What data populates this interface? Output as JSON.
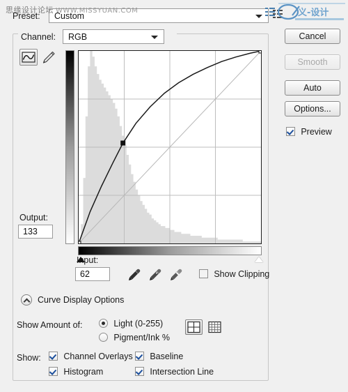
{
  "dialog": {
    "watermark_cn": "思缘设计论坛",
    "watermark_url": "WWW.MISSYUAN.COM",
    "logo_name": "missyuan-logo"
  },
  "preset": {
    "label": "Preset:",
    "value": "Custom",
    "menu_icon": "preset-menu-icon"
  },
  "channel": {
    "label": "Channel:",
    "value": "RGB"
  },
  "tools": {
    "curve_icon": "curve-draw-icon",
    "pencil_icon": "pencil-icon"
  },
  "graph": {
    "output_label": "Output:",
    "output_value": "133",
    "input_label": "Input:",
    "input_value": "62",
    "black_slider": "black-point-slider",
    "white_slider": "white-point-slider"
  },
  "eyedroppers": {
    "black": "black-point-eyedropper",
    "gray": "gray-point-eyedropper",
    "white": "white-point-eyedropper"
  },
  "show_clipping": {
    "label": "Show Clipping",
    "checked": false
  },
  "curve_display_options": {
    "title": "Curve Display Options",
    "expanded": true,
    "show_amount_label": "Show Amount of:",
    "radio_light": "Light  (0-255)",
    "radio_pigment": "Pigment/Ink %",
    "radio_selected": "light",
    "grid_coarse": "grid-coarse-button",
    "grid_fine": "grid-fine-button",
    "grid_selected": "coarse",
    "show_label": "Show:",
    "checkboxes": [
      {
        "label": "Channel Overlays",
        "checked": true
      },
      {
        "label": "Baseline",
        "checked": true
      },
      {
        "label": "Histogram",
        "checked": true
      },
      {
        "label": "Intersection Line",
        "checked": true
      }
    ]
  },
  "buttons": {
    "cancel": "Cancel",
    "smooth": "Smooth",
    "smooth_disabled": true,
    "auto": "Auto",
    "options": "Options...",
    "preview_label": "Preview",
    "preview_checked": true
  },
  "chart_data": {
    "type": "line",
    "title": "RGB Tone Curve",
    "xlabel": "Input",
    "ylabel": "Output",
    "xlim": [
      0,
      255
    ],
    "ylim": [
      0,
      255
    ],
    "grid": true,
    "grid_divisions": 4,
    "series": [
      {
        "name": "baseline",
        "x": [
          0,
          255
        ],
        "y": [
          0,
          255
        ]
      },
      {
        "name": "curve",
        "x": [
          0,
          16,
          32,
          48,
          62,
          80,
          100,
          120,
          140,
          160,
          180,
          200,
          220,
          240,
          255
        ],
        "y": [
          0,
          42,
          76,
          107,
          133,
          159,
          181,
          199,
          213,
          224,
          233,
          241,
          247,
          252,
          255
        ]
      }
    ],
    "control_points": [
      {
        "input": 0,
        "output": 0
      },
      {
        "input": 62,
        "output": 133
      },
      {
        "input": 255,
        "output": 255
      }
    ],
    "histogram": [
      2,
      10,
      34,
      66,
      92,
      100,
      97,
      92,
      88,
      85,
      83,
      81,
      79,
      77,
      75,
      73,
      70,
      66,
      61,
      56,
      51,
      46,
      41,
      36,
      32,
      28,
      25,
      22,
      20,
      18,
      16,
      15,
      13,
      12,
      11,
      10,
      9,
      9,
      8,
      8,
      7,
      7,
      6,
      6,
      6,
      5,
      5,
      5,
      5,
      4,
      4,
      4,
      4,
      4,
      3,
      3,
      3,
      3,
      3,
      3,
      3,
      2,
      2,
      2,
      2,
      2,
      2,
      2,
      2,
      2,
      2,
      2,
      1,
      1,
      1,
      1,
      1,
      1,
      1,
      1
    ]
  }
}
